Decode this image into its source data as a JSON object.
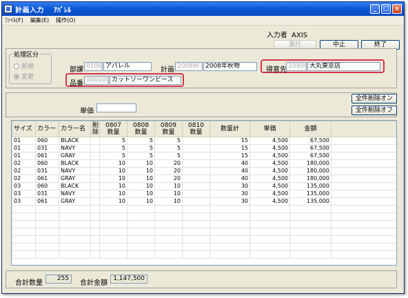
{
  "window": {
    "title": "計画入力",
    "subtitle": "ｱﾊﾟﾚﾙ",
    "min": "_",
    "max": "□",
    "close": "×"
  },
  "menu": [
    "ﾌｧｲﾙ(F)",
    "編集(E)",
    "操作(O)"
  ],
  "header": {
    "inputter_label": "入力者",
    "inputter_value": "AXIS",
    "exec_label": "実行",
    "cancel_label": "中止",
    "quit_label": "終了"
  },
  "form": {
    "mode_label": "処理区分",
    "mode_new": "新規",
    "mode_change": "変更",
    "dept_label": "部課",
    "dept_code": "0100",
    "dept_name": "アパレル",
    "plan_label": "計画",
    "plan_code": "2008秋",
    "plan_name": "2008年秋物",
    "customer_label": "得意先",
    "customer_code": "10400",
    "customer_name": "大丸東京店",
    "item_label": "品番",
    "item_code": "300200",
    "item_name": "カットソーワンピース",
    "unit_price_label": "単価",
    "unit_price_value": "",
    "delete_all_on": "全件削除オン",
    "delete_all_off": "全件削除オフ"
  },
  "table": {
    "headers": [
      "サイズ",
      "カラー",
      "カラー名",
      "削除",
      "0807\n数量",
      "0808\n数量",
      "0809\n数量",
      "0810\n数量",
      "数量計",
      "単価",
      "金額",
      ""
    ],
    "rows": [
      [
        "01",
        "060",
        "BLACK",
        "",
        "5",
        "5",
        "5",
        "",
        "15",
        "4,500",
        "67,500"
      ],
      [
        "01",
        "031",
        "NAVY",
        "",
        "5",
        "5",
        "5",
        "",
        "15",
        "4,500",
        "67,500"
      ],
      [
        "01",
        "061",
        "GRAY",
        "",
        "5",
        "5",
        "5",
        "",
        "15",
        "4,500",
        "67,500"
      ],
      [
        "02",
        "060",
        "BLACK",
        "",
        "10",
        "10",
        "20",
        "",
        "40",
        "4,500",
        "180,000"
      ],
      [
        "02",
        "031",
        "NAVY",
        "",
        "10",
        "10",
        "20",
        "",
        "40",
        "4,500",
        "180,000"
      ],
      [
        "02",
        "061",
        "GRAY",
        "",
        "10",
        "10",
        "20",
        "",
        "40",
        "4,500",
        "180,000"
      ],
      [
        "03",
        "060",
        "BLACK",
        "",
        "10",
        "10",
        "10",
        "",
        "30",
        "4,500",
        "135,000"
      ],
      [
        "03",
        "031",
        "NAVY",
        "",
        "10",
        "10",
        "10",
        "",
        "30",
        "4,500",
        "135,000"
      ],
      [
        "03",
        "061",
        "GRAY",
        "",
        "10",
        "10",
        "10",
        "",
        "30",
        "4,500",
        "135,000"
      ]
    ]
  },
  "footer": {
    "total_qty_label": "合計数量",
    "total_qty_value": "255",
    "total_amount_label": "合計金額",
    "total_amount_value": "1,147,500"
  },
  "colors": {
    "title_blue": "#0a58d8",
    "highlight_red": "#d4344a",
    "window_face": "#ece9d8"
  }
}
